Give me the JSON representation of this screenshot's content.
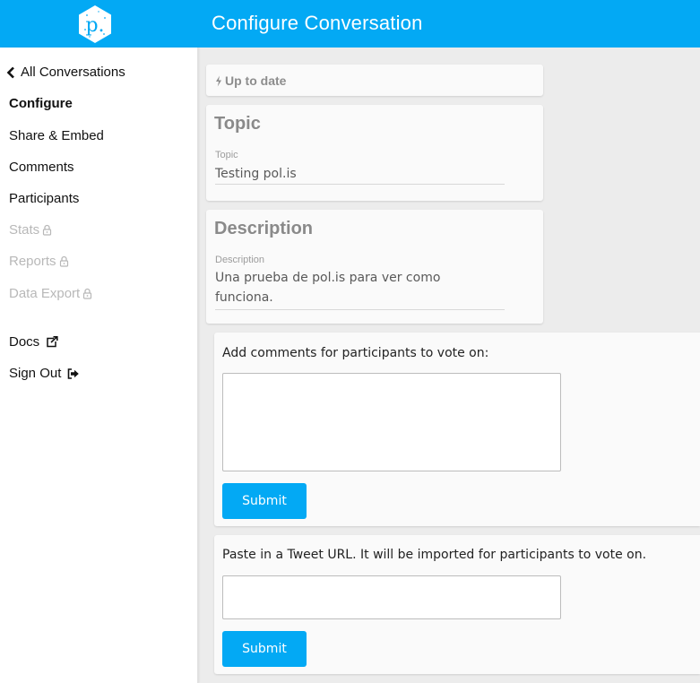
{
  "header": {
    "title": "Configure Conversation",
    "logo_letter": "p."
  },
  "sidebar": {
    "items": [
      {
        "label": "All Conversations",
        "icon": "chevron-left-icon",
        "state": "normal"
      },
      {
        "label": "Configure",
        "state": "active"
      },
      {
        "label": "Share & Embed",
        "state": "normal"
      },
      {
        "label": "Comments",
        "state": "normal"
      },
      {
        "label": "Participants",
        "state": "normal"
      },
      {
        "label": "Stats",
        "icon": "lock-icon",
        "state": "disabled"
      },
      {
        "label": "Reports",
        "icon": "lock-icon",
        "state": "disabled"
      },
      {
        "label": "Data Export",
        "icon": "lock-icon",
        "state": "disabled"
      },
      {
        "label": "Docs",
        "icon": "external-link-icon",
        "state": "normal"
      },
      {
        "label": "Sign Out",
        "icon": "sign-out-icon",
        "state": "normal"
      }
    ]
  },
  "status": {
    "text": "Up to date",
    "icon": "bolt-icon"
  },
  "topic": {
    "heading": "Topic",
    "label": "Topic",
    "value": "Testing pol.is"
  },
  "description": {
    "heading": "Description",
    "label": "Description",
    "value_line1": "Una prueba de pol.is para ver como",
    "value_line2": "funciona."
  },
  "add_comments": {
    "prompt": "Add comments for participants to vote on:",
    "value": "",
    "submit_label": "Submit"
  },
  "tweet_import": {
    "prompt": "Paste in a Tweet URL. It will be imported for participants to vote on.",
    "value": "",
    "submit_label": "Submit"
  },
  "colors": {
    "accent": "#03a9f4",
    "disabled_text": "#b8b8b8",
    "card_background": "#fafafa",
    "page_background": "#ececec"
  }
}
